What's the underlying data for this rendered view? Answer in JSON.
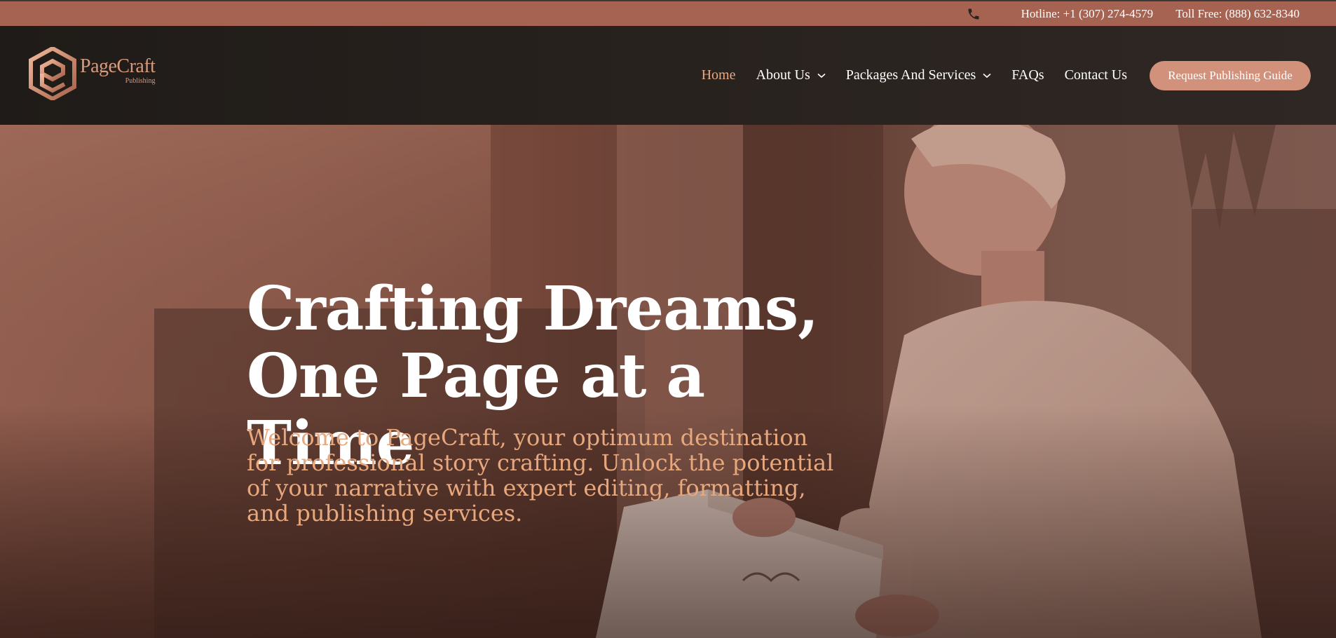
{
  "topbar": {
    "hotline": "Hotline: +1 (307) 274-4579",
    "tollfree": "Toll Free: (888) 632-8340",
    "icon": "phone-icon"
  },
  "brand": {
    "name": "PageCraft",
    "sub": "Publishing",
    "accent": "#d99a7c"
  },
  "nav": {
    "items": [
      {
        "label": "Home",
        "active": true
      },
      {
        "label": "About Us",
        "dropdown": true
      },
      {
        "label": "Packages And Services",
        "dropdown": true
      },
      {
        "label": "FAQs"
      },
      {
        "label": "Contact Us"
      }
    ],
    "cta": "Request Publishing Guide"
  },
  "hero": {
    "title_line1": "Crafting Dreams,",
    "title_line2": "One Page at a Time",
    "text_line1": "Welcome to PageCraft, your optimum destination",
    "text_line2": "for professional story crafting. Unlock the potential",
    "text_line3": "of your narrative with expert editing, formatting,",
    "text_line4": "and publishing services."
  },
  "colors": {
    "topbar": "#a66352",
    "header": "#28221e",
    "active_nav": "#e6a885",
    "cta": "#d2917a",
    "hero_text": "#e8a87e"
  }
}
